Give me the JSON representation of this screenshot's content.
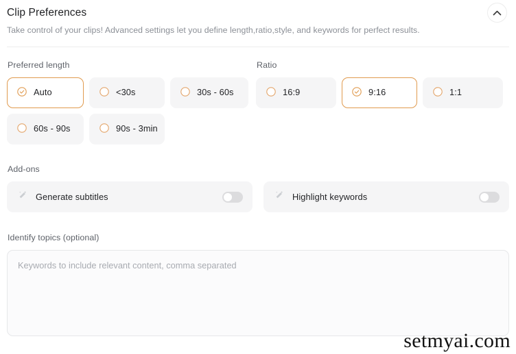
{
  "panel": {
    "title": "Clip Preferences",
    "subtitle": "Take control of your clips! Advanced settings let you define length,ratio,style, and keywords for perfect results.",
    "collapse_icon": "chevron-up-icon"
  },
  "colors": {
    "accent": "#e09a4e",
    "chip_bg": "#f5f5f6",
    "text": "#1f2023",
    "muted": "#8b8f96",
    "toggle_off": "#dcdcde"
  },
  "preferred_length": {
    "label": "Preferred length",
    "options": [
      {
        "label": "Auto",
        "selected": true
      },
      {
        "label": "<30s",
        "selected": false
      },
      {
        "label": "30s - 60s",
        "selected": false
      },
      {
        "label": "60s - 90s",
        "selected": false
      },
      {
        "label": "90s - 3min",
        "selected": false
      }
    ]
  },
  "ratio": {
    "label": "Ratio",
    "options": [
      {
        "label": "16:9",
        "selected": false
      },
      {
        "label": "9:16",
        "selected": true
      },
      {
        "label": "1:1",
        "selected": false
      }
    ]
  },
  "addons": {
    "label": "Add-ons",
    "items": [
      {
        "label": "Generate subtitles",
        "icon": "magic-wand-icon",
        "enabled": false
      },
      {
        "label": "Highlight keywords",
        "icon": "magic-wand-icon",
        "enabled": false
      }
    ]
  },
  "topics": {
    "label": "Identify topics (optional)",
    "placeholder": "Keywords to include relevant content, comma separated",
    "value": ""
  },
  "watermark": {
    "text": "setmyai.com"
  }
}
